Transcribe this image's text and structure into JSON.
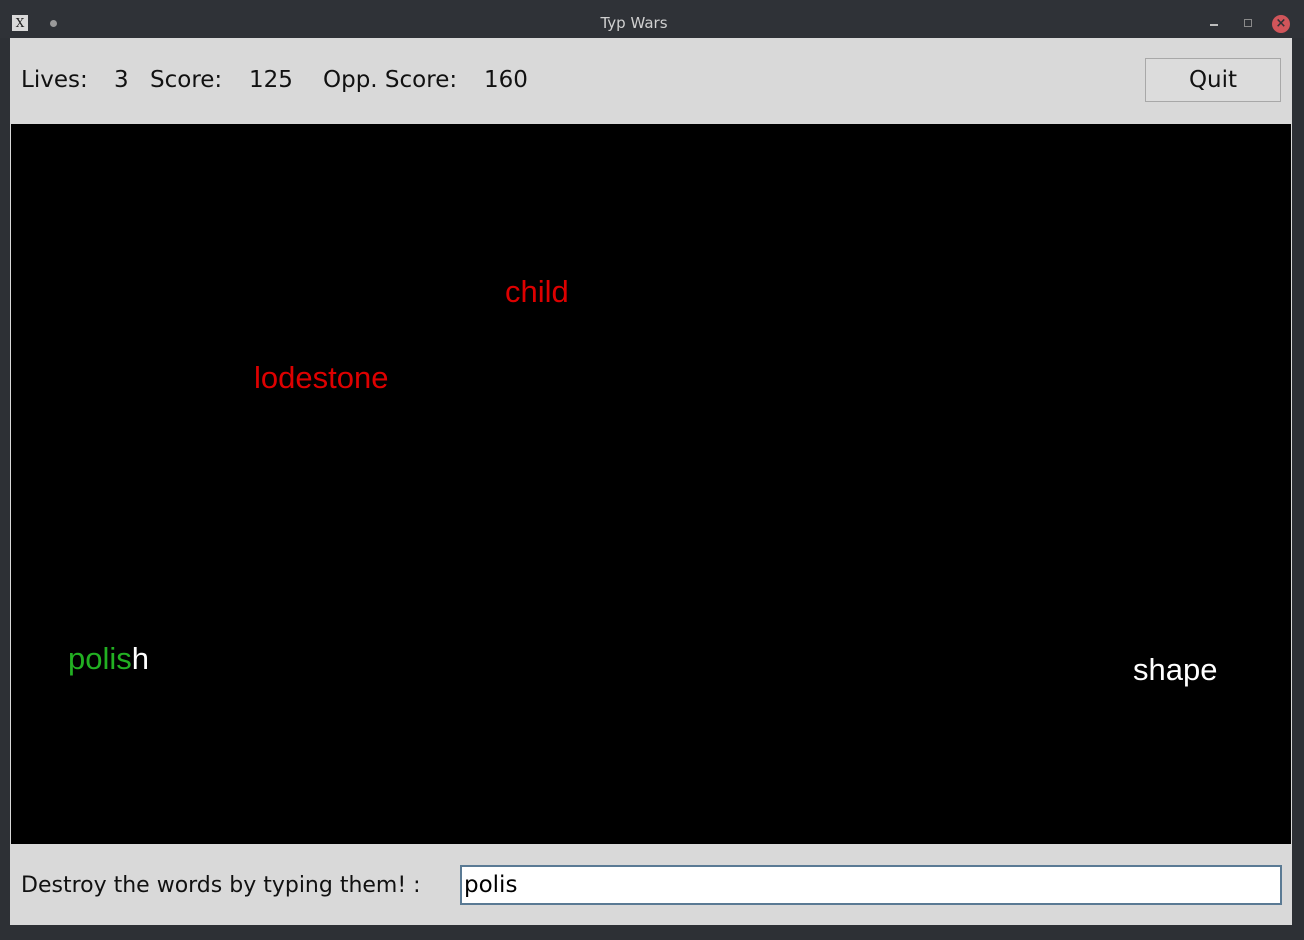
{
  "window": {
    "title": "Typ Wars",
    "app_icon": "X",
    "close_glyph": "×"
  },
  "status": {
    "lives_label": "Lives:",
    "lives_value": "3",
    "score_label": "Score:",
    "score_value": "125",
    "opp_label": "Opp. Score:",
    "opp_value": "160",
    "quit_label": "Quit"
  },
  "words": {
    "child": "child",
    "lodestone": "lodestone",
    "polish_typed": "polis",
    "polish_rest": "h",
    "shape": "shape"
  },
  "input": {
    "prompt": "Destroy the words by typing them! :",
    "value": "polis"
  },
  "colors": {
    "enemy_word": "#dd0000",
    "neutral_word": "#ffffff",
    "typed_highlight": "#22b022",
    "canvas_bg": "#000000",
    "panel_bg": "#d9d9d9"
  }
}
